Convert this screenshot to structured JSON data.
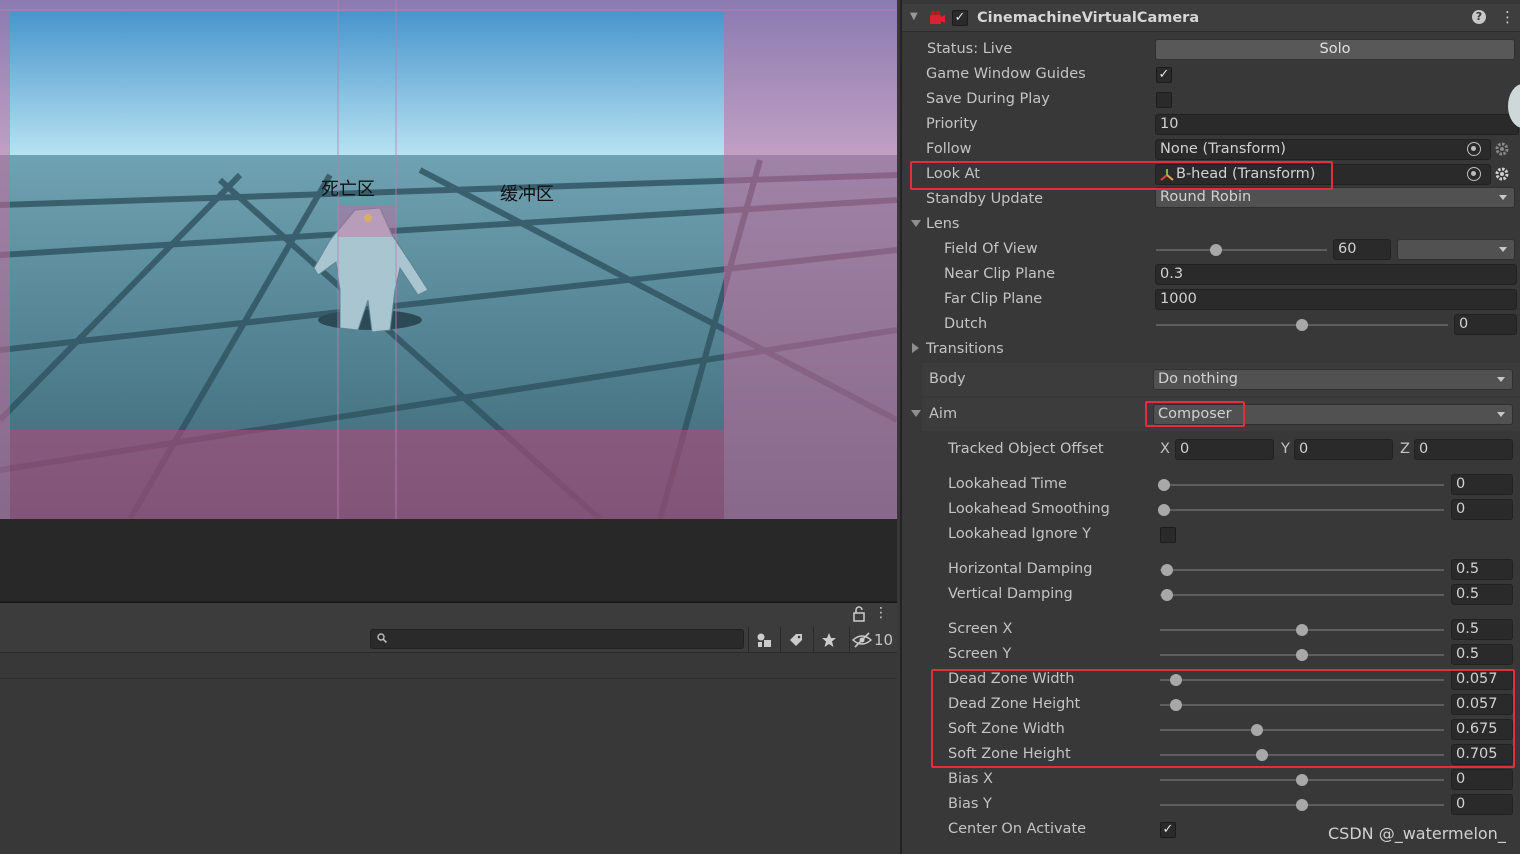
{
  "game_view": {
    "dead_zone_label": "死亡区",
    "soft_zone_label": "缓冲区"
  },
  "lower_panel": {
    "hidden_count": "10",
    "search_placeholder": ""
  },
  "component": {
    "title": "CinemachineVirtualCamera",
    "enabled": true
  },
  "fields": {
    "status": {
      "label": "Status: Live",
      "button": "Solo"
    },
    "game_window_guides": {
      "label": "Game Window Guides",
      "checked": true
    },
    "save_during_play": {
      "label": "Save During Play",
      "checked": false
    },
    "priority": {
      "label": "Priority",
      "value": "10"
    },
    "follow": {
      "label": "Follow",
      "value": "None (Transform)"
    },
    "look_at": {
      "label": "Look At",
      "value": "B-head (Transform)"
    },
    "standby_update": {
      "label": "Standby Update",
      "value": "Round Robin"
    },
    "lens": {
      "label": "Lens"
    },
    "field_of_view": {
      "label": "Field Of View",
      "value": "60",
      "slider": 0.35
    },
    "near_clip_plane": {
      "label": "Near Clip Plane",
      "value": "0.3"
    },
    "far_clip_plane": {
      "label": "Far Clip Plane",
      "value": "1000"
    },
    "dutch": {
      "label": "Dutch",
      "value": "0",
      "slider": 0.5
    },
    "transitions": {
      "label": "Transitions"
    },
    "body": {
      "label": "Body",
      "value": "Do nothing"
    },
    "aim": {
      "label": "Aim",
      "value": "Composer"
    },
    "tracked_object_offset": {
      "label": "Tracked Object Offset",
      "x_label": "X",
      "x": "0",
      "y_label": "Y",
      "y": "0",
      "z_label": "Z",
      "z": "0"
    },
    "lookahead_time": {
      "label": "Lookahead Time",
      "value": "0",
      "slider": 0.0
    },
    "lookahead_smoothing": {
      "label": "Lookahead Smoothing",
      "value": "0",
      "slider": 0.0
    },
    "lookahead_ignore_y": {
      "label": "Lookahead Ignore Y",
      "checked": false
    },
    "horizontal_damping": {
      "label": "Horizontal Damping",
      "value": "0.5",
      "slider": 0.025
    },
    "vertical_damping": {
      "label": "Vertical Damping",
      "value": "0.5",
      "slider": 0.025
    },
    "screen_x": {
      "label": "Screen X",
      "value": "0.5",
      "slider": 0.5
    },
    "screen_y": {
      "label": "Screen Y",
      "value": "0.5",
      "slider": 0.5
    },
    "dead_zone_width": {
      "label": "Dead Zone Width",
      "value": "0.057",
      "slider": 0.057
    },
    "dead_zone_height": {
      "label": "Dead Zone Height",
      "value": "0.057",
      "slider": 0.057
    },
    "soft_zone_width": {
      "label": "Soft Zone Width",
      "value": "0.675",
      "slider": 0.34
    },
    "soft_zone_height": {
      "label": "Soft Zone Height",
      "value": "0.705",
      "slider": 0.36
    },
    "bias_x": {
      "label": "Bias X",
      "value": "0",
      "slider": 0.5
    },
    "bias_y": {
      "label": "Bias Y",
      "value": "0",
      "slider": 0.5
    },
    "center_on_activate": {
      "label": "Center On Activate",
      "checked": true
    }
  },
  "watermark": "CSDN @_watermelon_",
  "colors": {
    "highlight_box": "#e0313a",
    "panel_bg": "#383838",
    "field_bg": "#2a2a2a"
  }
}
